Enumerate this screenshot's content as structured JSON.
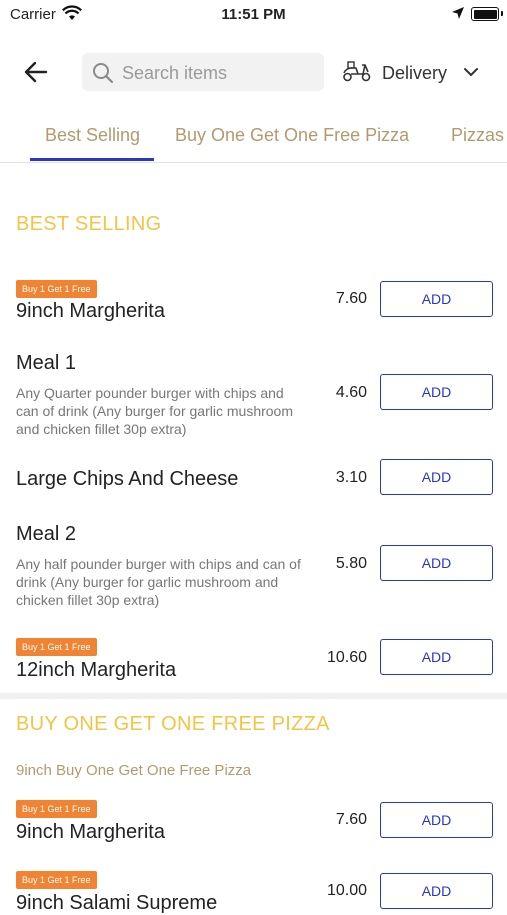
{
  "status_bar": {
    "carrier": "Carrier",
    "time": "11:51 PM"
  },
  "search": {
    "placeholder": "Search items"
  },
  "delivery": {
    "label": "Delivery"
  },
  "tabs": [
    {
      "label": "Best Selling",
      "active": true
    },
    {
      "label": "Buy One Get One Free Pizza",
      "active": false
    },
    {
      "label": "Pizzas",
      "active": false
    }
  ],
  "sections": [
    {
      "title": "BEST SELLING",
      "items": [
        {
          "badge": "Buy 1 Get 1 Free",
          "name": "9inch Margherita",
          "description": "",
          "price": "7.60",
          "button": "ADD"
        },
        {
          "badge": "",
          "name": "Meal 1",
          "description": "Any Quarter pounder burger with chips and can of drink (Any burger for garlic mushroom and chicken fillet 30p extra)",
          "price": "4.60",
          "button": "ADD"
        },
        {
          "badge": "",
          "name": "Large Chips And Cheese",
          "description": "",
          "price": "3.10",
          "button": "ADD"
        },
        {
          "badge": "",
          "name": "Meal 2",
          "description": "Any half pounder burger with chips and can of drink (Any burger for garlic mushroom and chicken fillet 30p extra)",
          "price": "5.80",
          "button": "ADD"
        },
        {
          "badge": "Buy 1 Get 1 Free",
          "name": "12inch Margherita",
          "description": "",
          "price": "10.60",
          "button": "ADD"
        }
      ]
    },
    {
      "title": "BUY ONE GET ONE FREE PIZZA",
      "subtitle": "9inch Buy One Get One Free Pizza",
      "items": [
        {
          "badge": "Buy 1 Get 1 Free",
          "name": "9inch Margherita",
          "description": "",
          "price": "7.60",
          "button": "ADD"
        },
        {
          "badge": "Buy 1 Get 1 Free",
          "name": "9inch Salami Supreme",
          "description": "",
          "price": "10.00",
          "button": "ADD"
        }
      ]
    }
  ],
  "colors": {
    "accent": "#2a36c6",
    "section_title": "#f2c547",
    "tab_text": "#b39a6e",
    "badge": "#f08432"
  }
}
